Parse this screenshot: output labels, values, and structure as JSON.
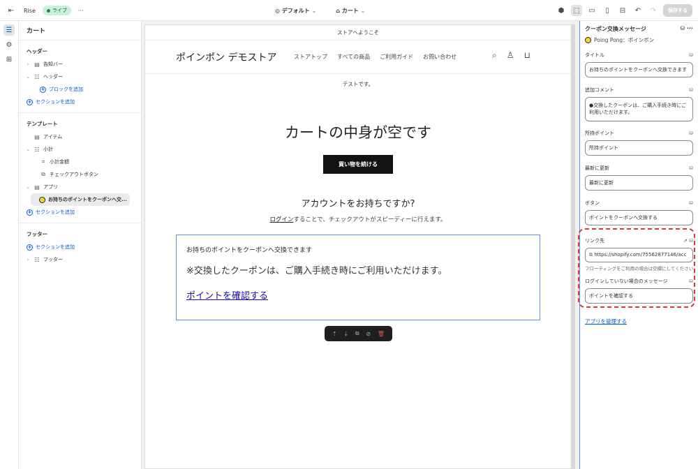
{
  "topbar": {
    "store_name": "Rise",
    "live_label": "ライブ",
    "more": "···",
    "theme_select": "デフォルト",
    "page_select": "カート",
    "save_label": "保存する"
  },
  "sidebar": {
    "title": "カート",
    "header_group": {
      "title": "ヘッダー",
      "items": [
        {
          "label": "告知バー"
        },
        {
          "label": "ヘッダー"
        }
      ],
      "add_block": "ブロックを追加",
      "add_section": "セクションを追加"
    },
    "template_group": {
      "title": "テンプレート",
      "items": [
        {
          "label": "アイテム"
        },
        {
          "label": "小計"
        },
        {
          "label": "小計金額"
        },
        {
          "label": "チェックアウトボタン"
        },
        {
          "label": "アプリ"
        },
        {
          "label": "お持ちのポイントをクーポンへ交..."
        }
      ],
      "add_section": "セクションを追加"
    },
    "footer_group": {
      "title": "フッター",
      "add_section": "セクションを追加",
      "items": [
        {
          "label": "フッター"
        }
      ]
    }
  },
  "preview": {
    "announcement": "ストアへようこそ",
    "store_name": "ポインポン デモストア",
    "nav": [
      "ストアトップ",
      "すべての商品",
      "ご利用ガイド",
      "お問い合わせ"
    ],
    "test_text": "テストです。",
    "empty_title": "カートの中身が空です",
    "continue_button": "買い物を続ける",
    "account_title": "アカウントをお持ちですか?",
    "account_login": "ログイン",
    "account_sub_rest": "することで、チェックアウトがスピーディーに行えます。",
    "app_block": {
      "title": "お持ちのポイントをクーポンへ交換できます",
      "comment": "※交換したクーポンは、ご購入手続き時にご利用いただけます。",
      "link_text": "ポイントを確認する"
    }
  },
  "inspector": {
    "title": "クーポン交換メッセージ",
    "app_name": "Poing Pong：ポインポン",
    "fields": {
      "title_label": "タイトル",
      "title_value": "お持ちのポイントをクーポンへ交換できます",
      "comment_label": "追加コメント",
      "comment_value": "●交換したクーポンは、ご購入手続き時にご利用いただけます。",
      "points_label": "所持ポイント",
      "points_value": "所持ポイント",
      "updated_label": "最新に更新",
      "updated_value": "最新に更新",
      "button_label": "ボタン",
      "button_value": "ポイントをクーポンへ交換する",
      "link_label": "リンク先",
      "link_value": "https://shopify.com/75562877146/acc",
      "link_help": "フローティングをご利用の場合は空欄にしてください",
      "logout_label": "ログインしていない場合のメッセージ",
      "logout_value": "ポイントを確認する"
    },
    "manage_link": "アプリを管理する"
  }
}
